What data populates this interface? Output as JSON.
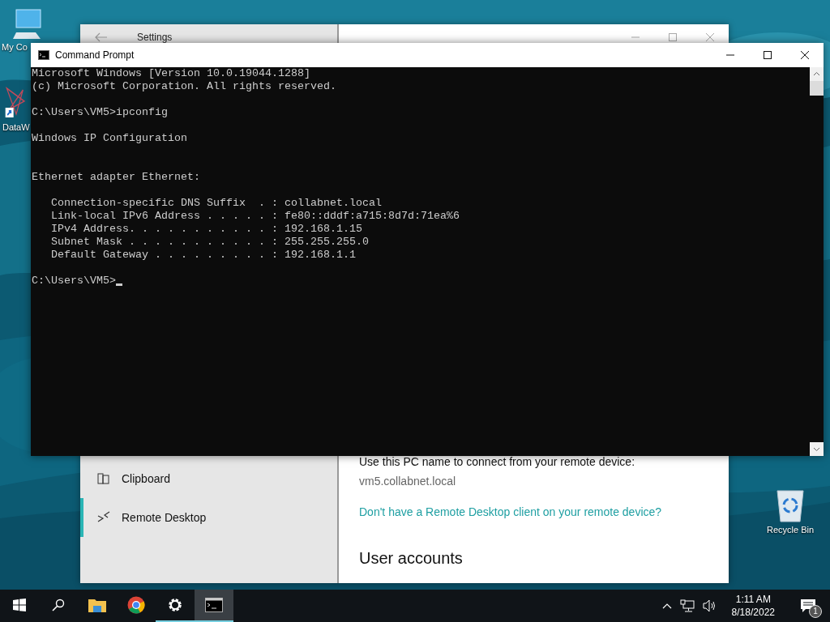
{
  "desktop": {
    "icons": [
      {
        "kind": "computer",
        "label": "My Co"
      },
      {
        "kind": "shortcut",
        "label": "DataW"
      },
      {
        "kind": "recycle",
        "label": "Recycle Bin"
      }
    ]
  },
  "settings_window": {
    "title": "Settings",
    "sidebar": {
      "items": [
        {
          "kind": "clipboard",
          "label": "Clipboard",
          "selected": false
        },
        {
          "kind": "remote",
          "label": "Remote Desktop",
          "selected": true
        }
      ]
    },
    "content": {
      "description": "Use this PC name to connect from your remote device:",
      "pc_name": "vm5.collabnet.local",
      "link": "Don't have a Remote Desktop client on your remote device?",
      "heading": "User accounts"
    }
  },
  "command_prompt": {
    "title": "Command Prompt",
    "cursor": true,
    "blocks": [
      {
        "kind": "output",
        "lines": [
          "Microsoft Windows [Version 10.0.19044.1288]",
          "(c) Microsoft Corporation. All rights reserved."
        ]
      },
      {
        "kind": "output",
        "lines": [
          "C:\\Users\\VM5>ipconfig"
        ]
      },
      {
        "kind": "output",
        "lines": [
          "Windows IP Configuration"
        ]
      },
      {
        "kind": "section",
        "lines": [
          "Ethernet adapter Ethernet:"
        ]
      },
      {
        "kind": "output",
        "lines": [
          "   Connection-specific DNS Suffix  . : collabnet.local",
          "   Link-local IPv6 Address . . . . . : fe80::dddf:a715:8d7d:71ea%6",
          "   IPv4 Address. . . . . . . . . . . : 192.168.1.15",
          "   Subnet Mask . . . . . . . . . . . : 255.255.255.0",
          "   Default Gateway . . . . . . . . . : 192.168.1.1"
        ]
      },
      {
        "kind": "prompt",
        "lines": [
          "C:\\Users\\VM5>"
        ]
      }
    ]
  },
  "taskbar": {
    "apps": [
      {
        "kind": "folder",
        "running": false,
        "selected": false
      },
      {
        "kind": "browser",
        "running": false,
        "selected": false
      },
      {
        "kind": "gear",
        "running": true,
        "selected": false
      },
      {
        "kind": "terminal",
        "running": true,
        "selected": true
      }
    ],
    "time": "1:11 AM",
    "date": "8/18/2022",
    "notifications": "1"
  }
}
